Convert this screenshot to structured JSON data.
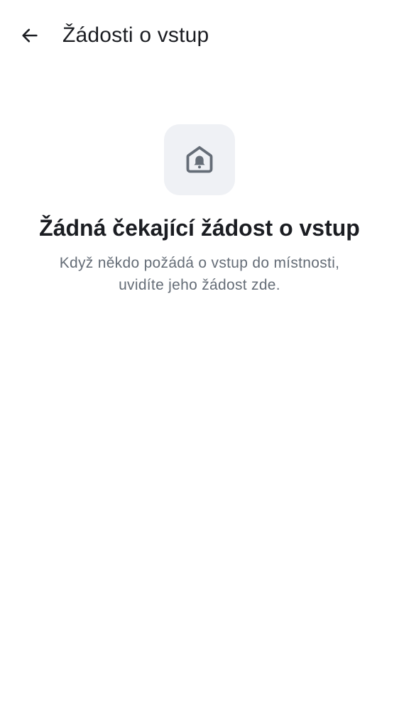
{
  "header": {
    "back_icon": "arrow-left-icon",
    "title": "Žádosti o vstup"
  },
  "empty_state": {
    "icon": "home-bell-icon",
    "title": "Žádná čekající žádost o vstup",
    "description_line1": "Když někdo požádá o vstup do místnosti,",
    "description_line2": "uvidíte jeho žádost zde."
  },
  "colors": {
    "background": "#ffffff",
    "text_primary": "#1b1d22",
    "text_secondary": "#656d77",
    "icon_box_bg": "#eff1f5",
    "icon_color": "#656d77"
  }
}
